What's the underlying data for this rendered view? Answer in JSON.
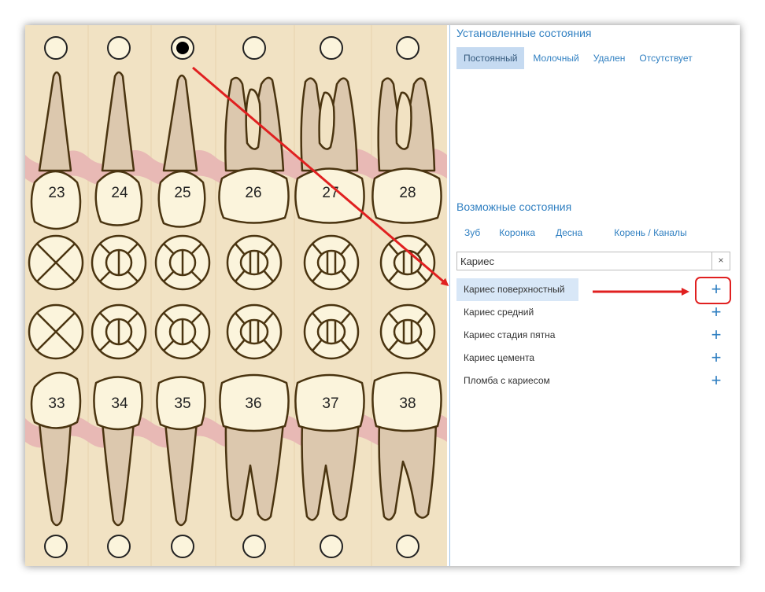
{
  "teeth_chart": {
    "upper_numbers": [
      "23",
      "24",
      "25",
      "26",
      "27",
      "28"
    ],
    "lower_numbers": [
      "33",
      "34",
      "35",
      "36",
      "37",
      "38"
    ],
    "selected_tooth": "25"
  },
  "established": {
    "title": "Установленные состояния",
    "tabs": [
      "Постоянный",
      "Молочный",
      "Удален",
      "Отсутствует"
    ],
    "active_tab": "Постоянный"
  },
  "possible": {
    "title": "Возможные состояния",
    "tabs": [
      "Зуб",
      "Коронка",
      "Десна",
      "Корень / Каналы"
    ],
    "search_value": "Кариес",
    "clear_label": "×",
    "items": [
      {
        "label": "Кариес поверхностный"
      },
      {
        "label": "Кариес средний"
      },
      {
        "label": "Кариес стадия пятна"
      },
      {
        "label": "Кариес цемента"
      },
      {
        "label": "Пломба с кариесом"
      }
    ],
    "selected_item": "Кариес поверхностный",
    "add_icon": "plus-icon"
  },
  "colors": {
    "accent": "#2f7fc1",
    "chart_bg": "#f1e2c3",
    "gum": "#e8b9b5",
    "crown": "#fbf4dc",
    "root": "#dcc8ae",
    "outline": "#4a3410",
    "annotation": "#e02020"
  }
}
